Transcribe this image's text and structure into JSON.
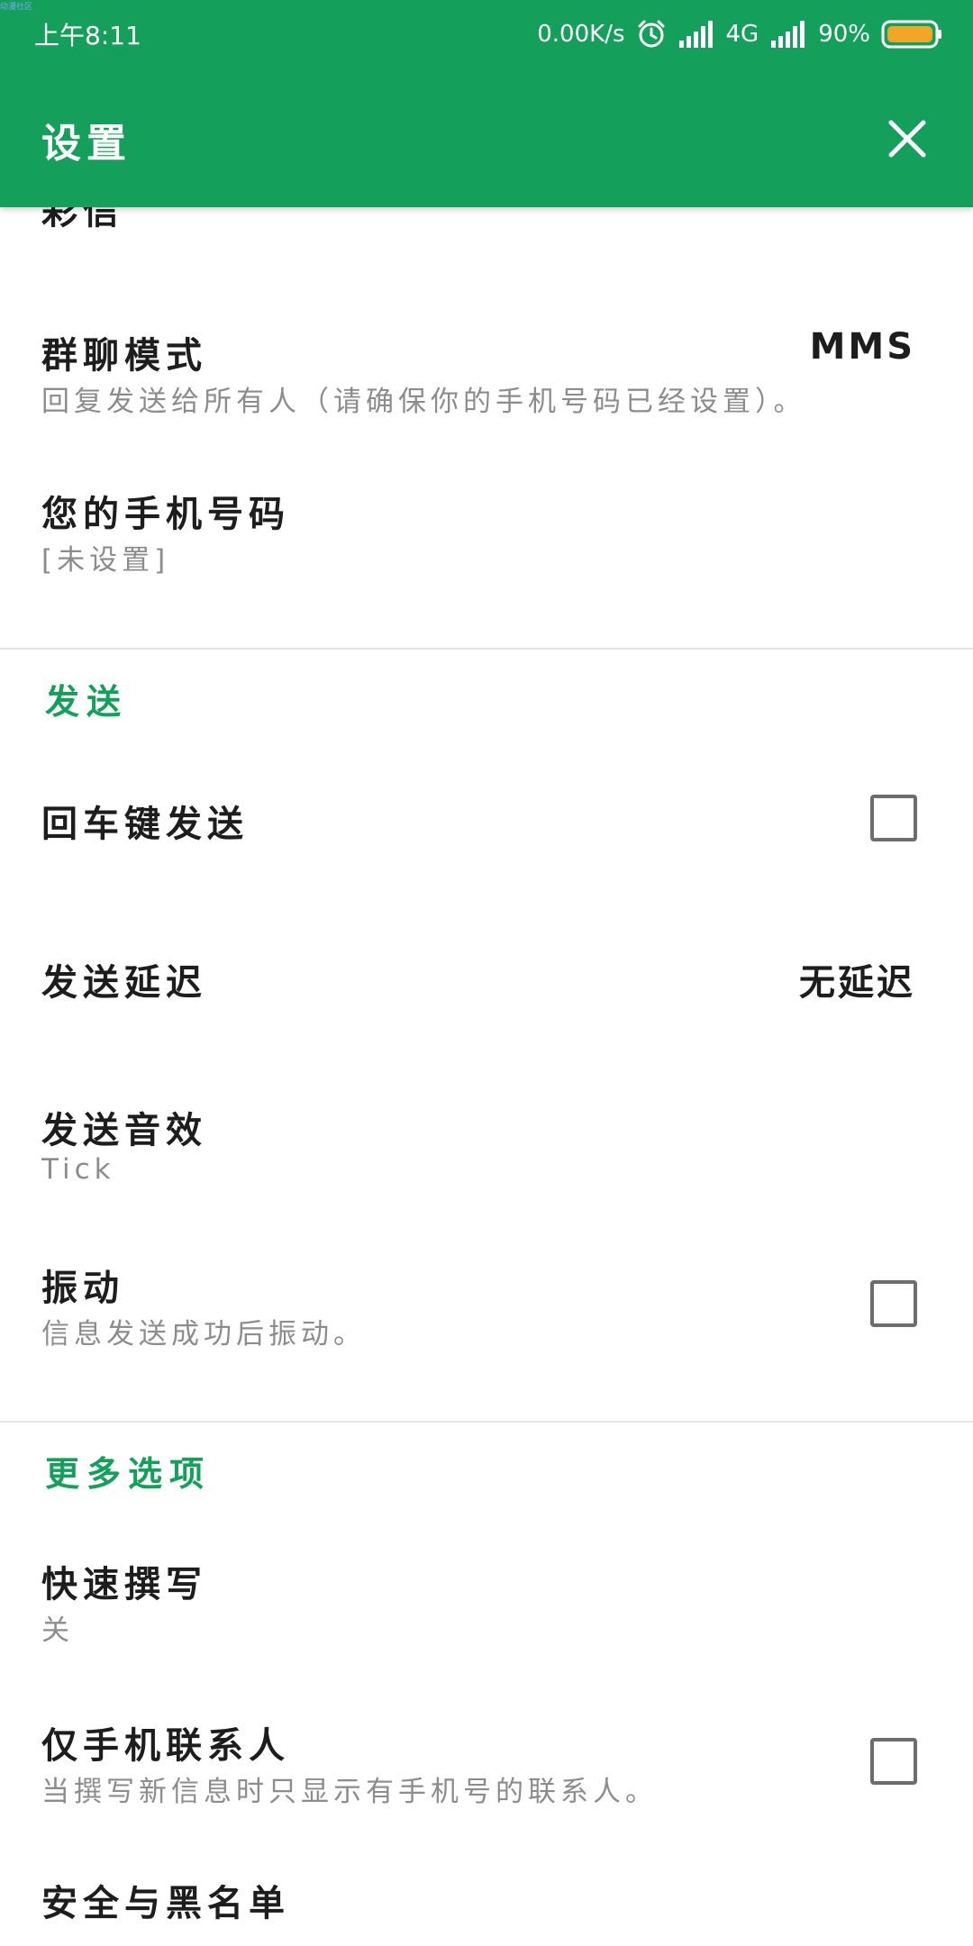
{
  "status_bar": {
    "watermark": "动漫社区",
    "time": "上午8:11",
    "net_speed": "0.00K/s",
    "network": "4G",
    "battery": "90%",
    "battery_color": "#f2a628"
  },
  "header": {
    "title": "设置",
    "close_icon": "close-icon",
    "color": "#14a05a"
  },
  "partial_item": {
    "title": "彩信"
  },
  "items": {
    "group_mode": {
      "title": "群聊模式",
      "subtitle": "回复发送给所有人（请确保你的手机号码已经设置）。",
      "value": "MMS"
    },
    "phone_number": {
      "title": "您的手机号码",
      "subtitle": "[未设置]"
    }
  },
  "sections": {
    "send": {
      "header": "发送",
      "enter_to_send": {
        "title": "回车键发送",
        "checked": false
      },
      "send_delay": {
        "title": "发送延迟",
        "value": "无延迟"
      },
      "send_sound": {
        "title": "发送音效",
        "subtitle": "Tick"
      },
      "vibrate": {
        "title": "振动",
        "subtitle": "信息发送成功后振动。",
        "checked": false
      }
    },
    "more": {
      "header": "更多选项",
      "quick_compose": {
        "title": "快速撰写",
        "subtitle": "关"
      },
      "mobile_only": {
        "title": "仅手机联系人",
        "subtitle": "当撰写新信息时只显示有手机号的联系人。",
        "checked": false
      },
      "blocking": {
        "title": "安全与黑名单"
      }
    }
  }
}
